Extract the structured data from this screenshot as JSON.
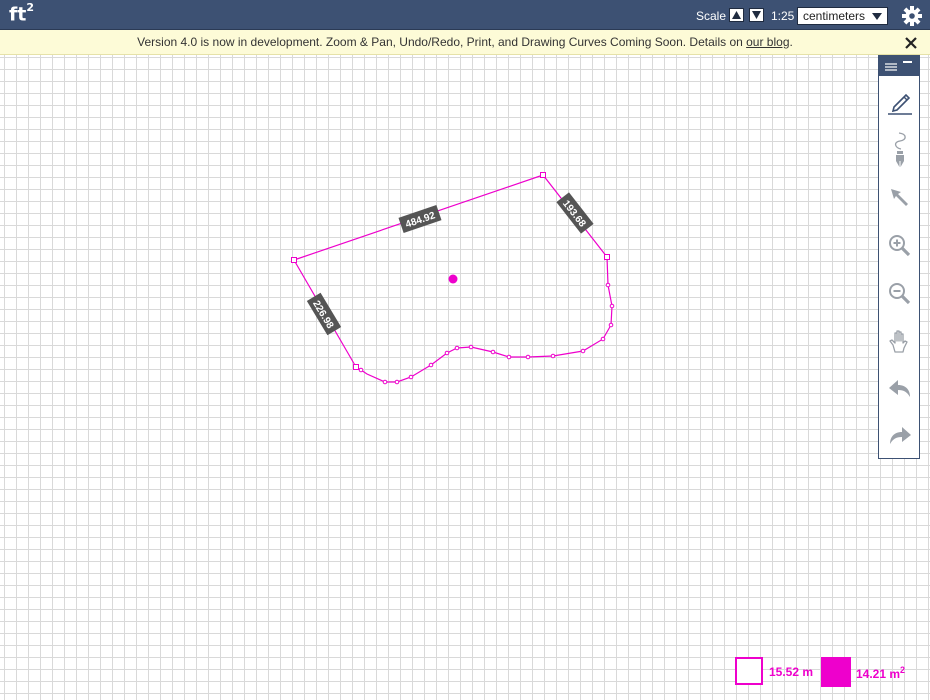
{
  "app": {
    "logo": "ft",
    "logo_sup": "2"
  },
  "header": {
    "scale_label": "Scale",
    "scale_value": "1:25",
    "units_selected": "centimeters"
  },
  "notice": {
    "text": "Version 4.0 is now in development. Zoom & Pan, Undo/Redo, Print, and Drawing Curves Coming Soon. Details on ",
    "link_text": "our blog",
    "suffix": "."
  },
  "toolbar": {
    "tools": [
      "pencil-icon",
      "pen-curve-icon",
      "select-arrow-icon",
      "zoom-in-icon",
      "zoom-out-icon",
      "hand-pan-icon",
      "undo-icon",
      "redo-icon"
    ]
  },
  "drawing": {
    "color": "#ee00cc",
    "measurements": [
      "484.92",
      "193.68",
      "226.98"
    ]
  },
  "status": {
    "perimeter": "15.52 m",
    "area": "14.21 m",
    "area_sup": "2"
  },
  "colors": {
    "header_bg": "#3d5173",
    "notice_bg": "#fdfbd7",
    "accent": "#ee00cc",
    "grid": "#d9d9d9",
    "label_bg": "#555555"
  }
}
